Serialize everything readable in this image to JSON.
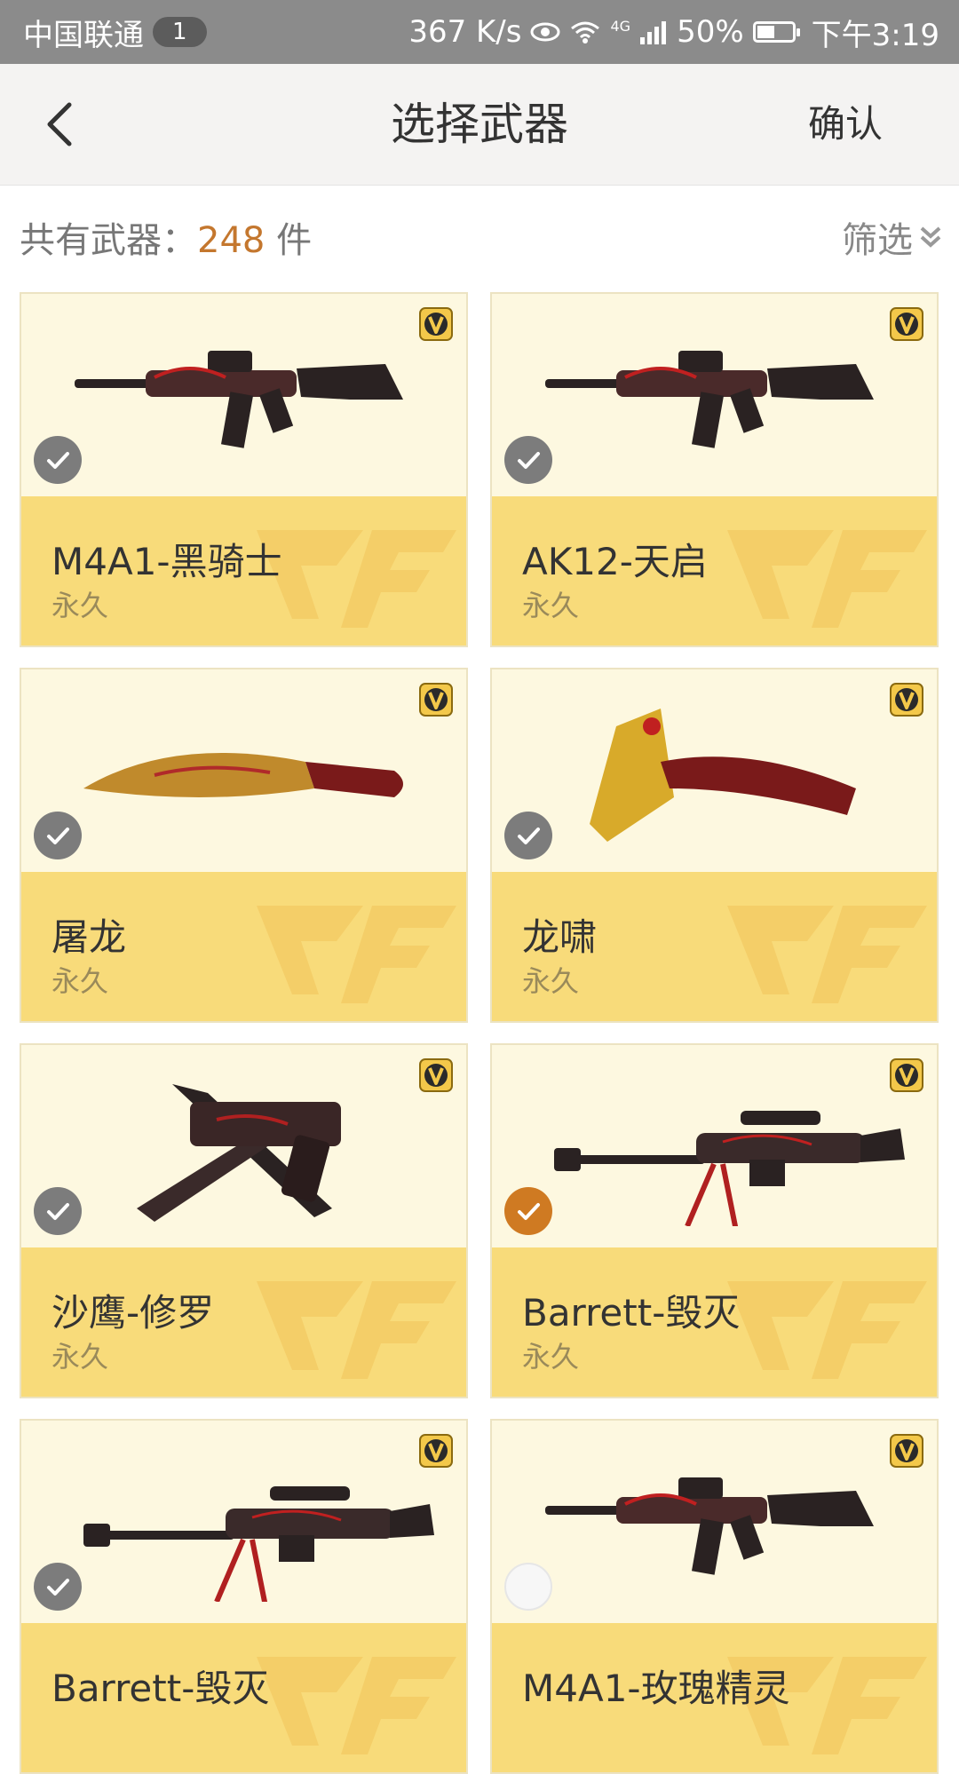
{
  "status_bar": {
    "carrier": "中国联通",
    "sim_badge": "1",
    "speed": "367 K/s",
    "network": "4G",
    "battery": "50%",
    "battery_level": 0.5,
    "time": "下午3:19"
  },
  "nav": {
    "title": "选择武器",
    "confirm_label": "确认"
  },
  "summary": {
    "prefix": "共有武器：",
    "count": "248",
    "suffix": " 件",
    "filter_label": "筛选"
  },
  "colors": {
    "accent": "#c4772e",
    "card_top": "#fdf8e0",
    "card_bottom": "#f8db7a",
    "check_selected": "#cf7a22",
    "check_default": "#7c7c7c"
  },
  "weapons": [
    {
      "name": "M4A1-黑骑士",
      "term": "永久",
      "state": "checked",
      "icon": "rifle-icon"
    },
    {
      "name": "AK12-天启",
      "term": "永久",
      "state": "checked",
      "icon": "rifle-icon"
    },
    {
      "name": "屠龙",
      "term": "永久",
      "state": "checked",
      "icon": "machete-icon"
    },
    {
      "name": "龙啸",
      "term": "永久",
      "state": "checked",
      "icon": "axe-icon"
    },
    {
      "name": "沙鹰-修罗",
      "term": "永久",
      "state": "checked",
      "icon": "pistol-knife-icon"
    },
    {
      "name": "Barrett-毁灭",
      "term": "永久",
      "state": "selected",
      "icon": "sniper-icon"
    },
    {
      "name": "Barrett-毁灭",
      "term": "",
      "state": "checked",
      "icon": "sniper-icon"
    },
    {
      "name": "M4A1-玫瑰精灵",
      "term": "",
      "state": "unchecked",
      "icon": "rifle-icon"
    }
  ]
}
